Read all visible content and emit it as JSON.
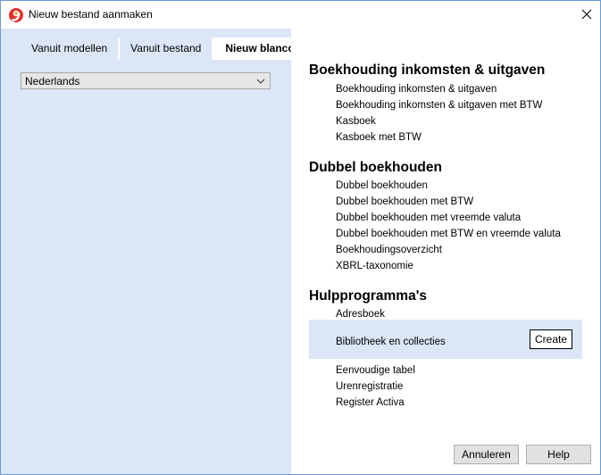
{
  "window": {
    "title": "Nieuw bestand aanmaken"
  },
  "icons": {
    "app": "banana-app-icon",
    "close": "close-icon",
    "dropdown": "chevron-down-icon"
  },
  "colors": {
    "panel": "#dbe6f7",
    "border": "#6e9ad6",
    "app_icon_primary": "#e3312d",
    "app_icon_secondary": "#f4a21a"
  },
  "tabs": [
    {
      "label": "Vanuit modellen",
      "active": false
    },
    {
      "label": "Vanuit bestand",
      "active": false
    },
    {
      "label": "Nieuw blanco",
      "active": true
    }
  ],
  "language": {
    "selected": "Nederlands"
  },
  "sections": [
    {
      "title": "Boekhouding inkomsten & uitgaven",
      "items": [
        "Boekhouding inkomsten & uitgaven",
        "Boekhouding inkomsten & uitgaven met BTW",
        "Kasboek",
        "Kasboek met BTW"
      ]
    },
    {
      "title": "Dubbel boekhouden",
      "items": [
        "Dubbel boekhouden",
        "Dubbel boekhouden met BTW",
        "Dubbel boekhouden met vreemde valuta",
        "Dubbel boekhouden met BTW en vreemde valuta",
        "Boekhoudingsoverzicht",
        "XBRL-taxonomie"
      ]
    },
    {
      "title": "Hulpprogramma's",
      "items": [
        "Adresboek",
        "Bibliotheek en collecties",
        "Eenvoudige tabel",
        "Urenregistratie",
        "Register Activa"
      ]
    }
  ],
  "create_button": "Create",
  "buttons": {
    "cancel": "Annuleren",
    "help": "Help"
  }
}
